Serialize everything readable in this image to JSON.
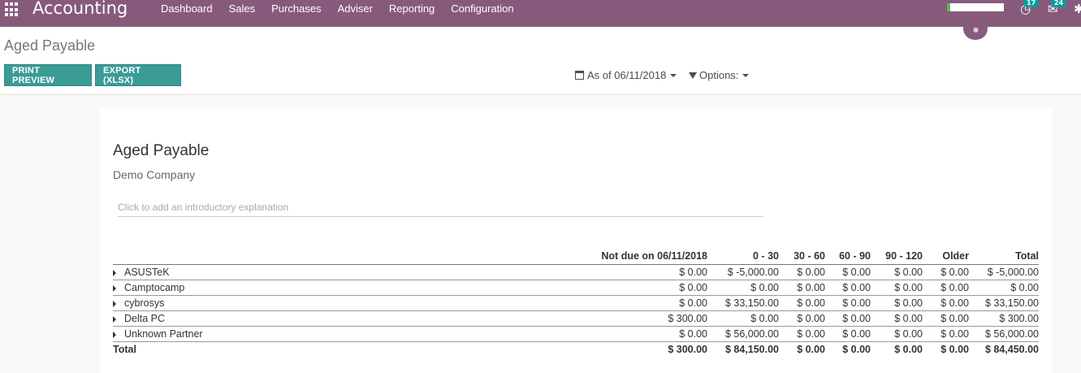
{
  "navbar": {
    "brand": "Accounting",
    "menu": [
      "Dashboard",
      "Sales",
      "Purchases",
      "Adviser",
      "Reporting",
      "Configuration"
    ],
    "activity_count": "17",
    "message_count": "24",
    "color": "#875a7b"
  },
  "control_panel": {
    "title": "Aged Payable",
    "print_label": "PRINT PREVIEW",
    "export_label": "EXPORT (XLSX)",
    "date_filter": "As of 06/11/2018",
    "options_filter": "Options:"
  },
  "report": {
    "title": "Aged Payable",
    "company": "Demo Company",
    "intro_placeholder": "Click to add an introductory explanation",
    "columns": [
      "Not due on 06/11/2018",
      "0 - 30",
      "30 - 60",
      "60 - 90",
      "90 - 120",
      "Older",
      "Total"
    ],
    "rows": [
      {
        "name": "ASUSTeK",
        "values": [
          "$ 0.00",
          "$ -5,000.00",
          "$ 0.00",
          "$ 0.00",
          "$ 0.00",
          "$ 0.00",
          "$ -5,000.00"
        ]
      },
      {
        "name": "Camptocamp",
        "values": [
          "$ 0.00",
          "$ 0.00",
          "$ 0.00",
          "$ 0.00",
          "$ 0.00",
          "$ 0.00",
          "$ 0.00"
        ]
      },
      {
        "name": "cybrosys",
        "values": [
          "$ 0.00",
          "$ 33,150.00",
          "$ 0.00",
          "$ 0.00",
          "$ 0.00",
          "$ 0.00",
          "$ 33,150.00"
        ]
      },
      {
        "name": "Delta PC",
        "values": [
          "$ 300.00",
          "$ 0.00",
          "$ 0.00",
          "$ 0.00",
          "$ 0.00",
          "$ 0.00",
          "$ 300.00"
        ]
      },
      {
        "name": "Unknown Partner",
        "values": [
          "$ 0.00",
          "$ 56,000.00",
          "$ 0.00",
          "$ 0.00",
          "$ 0.00",
          "$ 0.00",
          "$ 56,000.00"
        ]
      }
    ],
    "total": {
      "name": "Total",
      "values": [
        "$ 300.00",
        "$ 84,150.00",
        "$ 0.00",
        "$ 0.00",
        "$ 0.00",
        "$ 0.00",
        "$ 84,450.00"
      ]
    }
  }
}
